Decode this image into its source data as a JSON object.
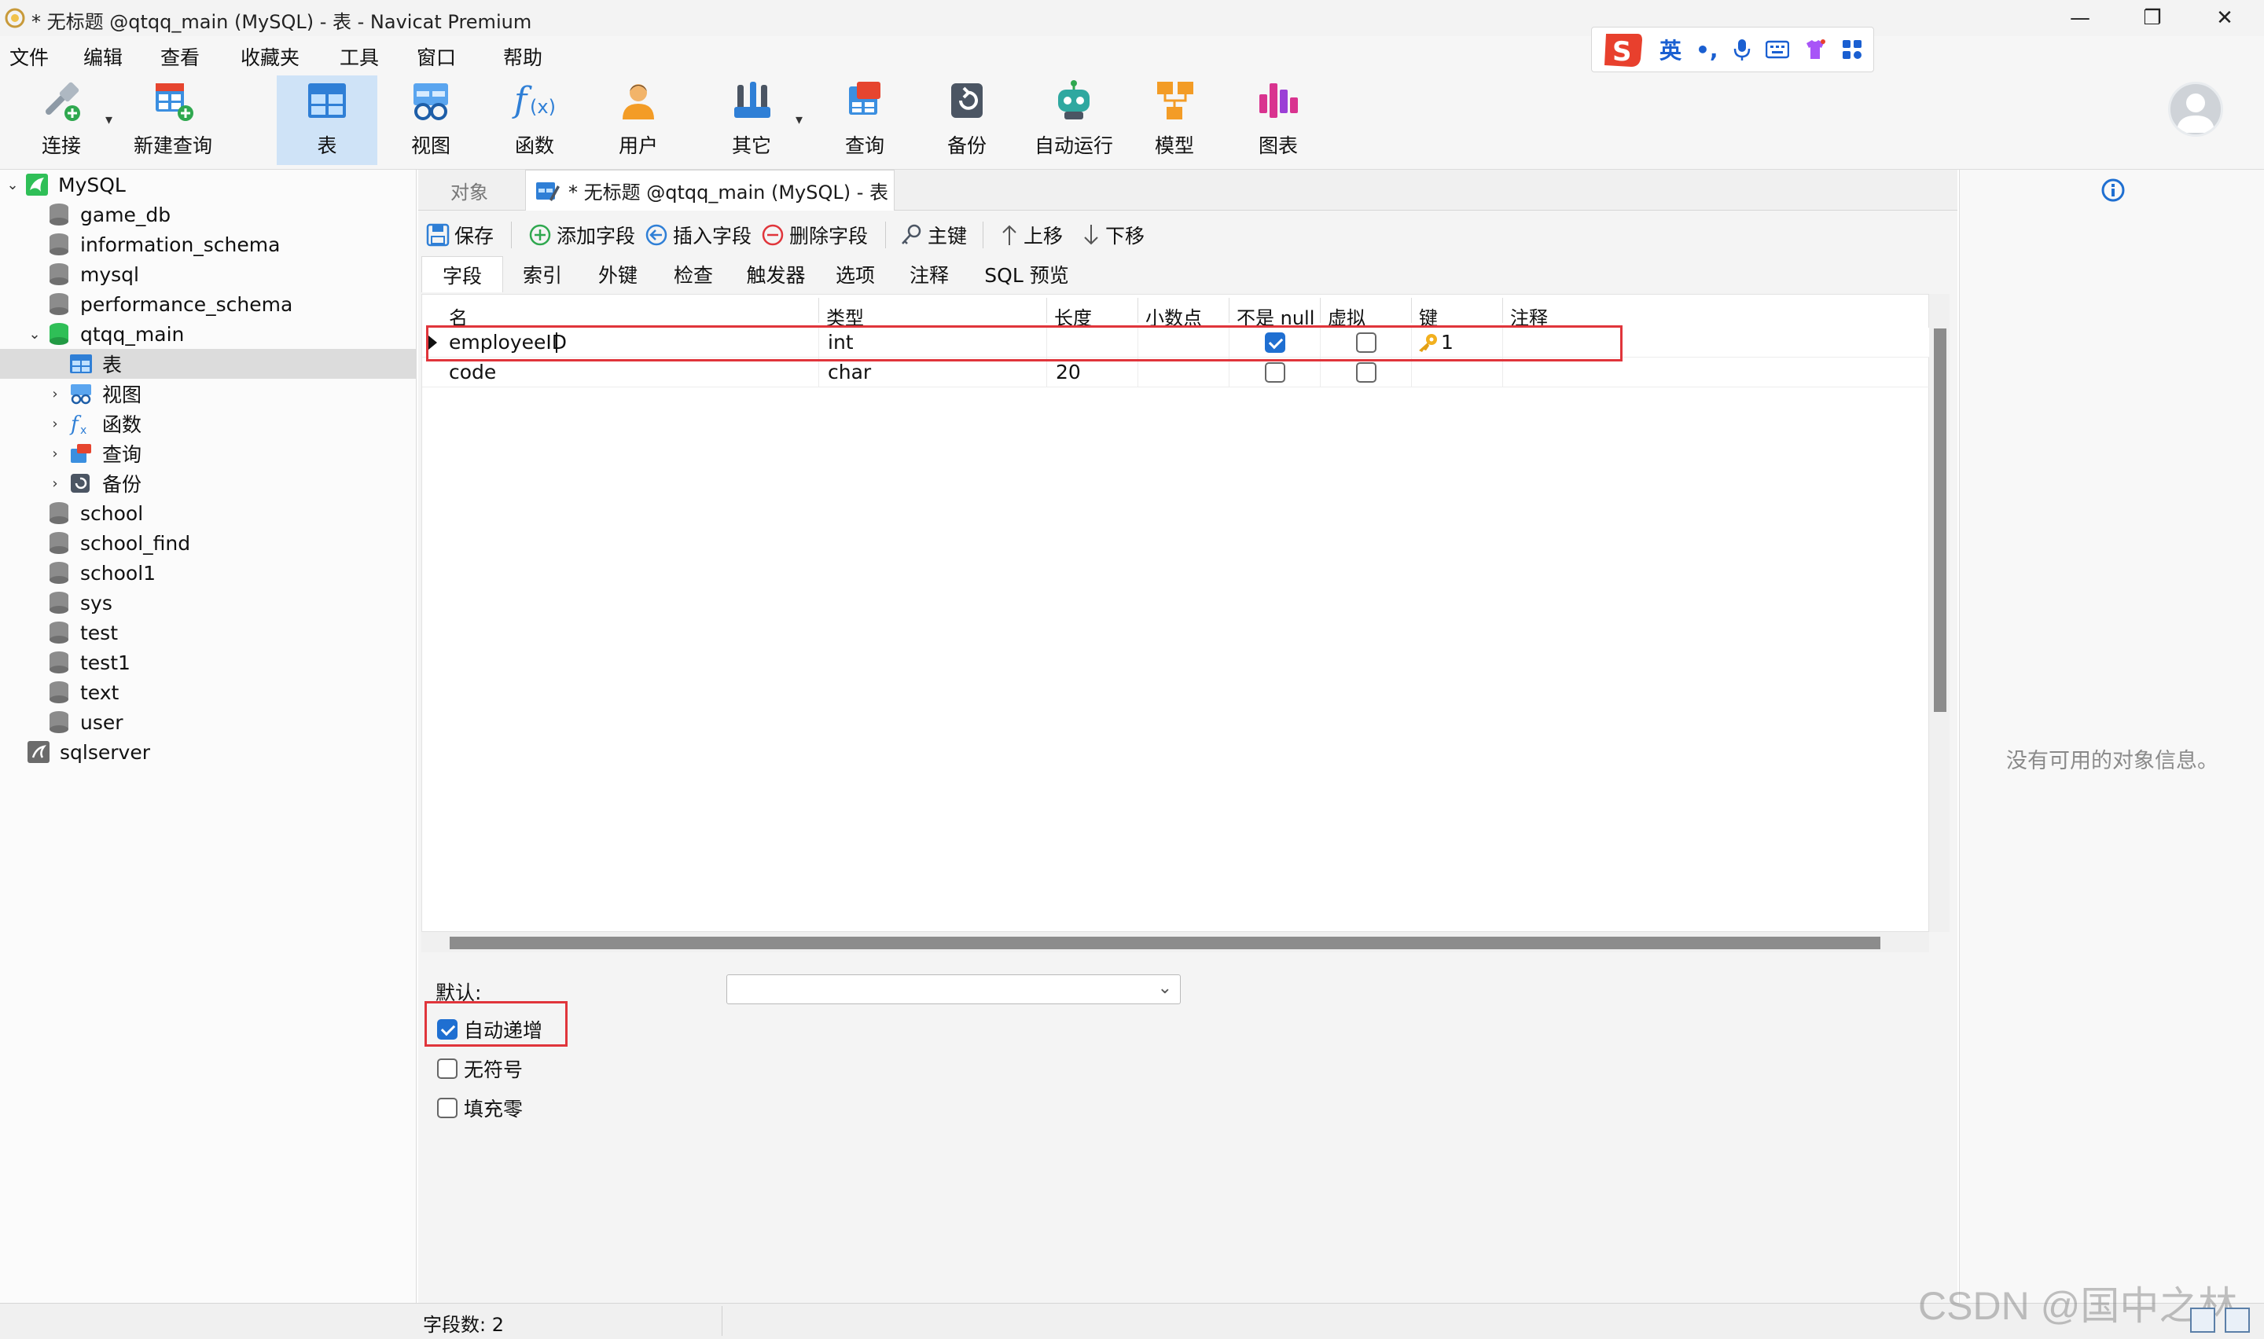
{
  "window": {
    "title": "* 无标题 @qtqq_main (MySQL) - 表 - Navicat Premium",
    "minimize": "—",
    "restore": "❐",
    "close": "✕"
  },
  "ime": {
    "lang": "英",
    "punct": "•,",
    "colors": {
      "logo": "#e8402d",
      "blue": "#1a5fd1"
    }
  },
  "menu": [
    "文件",
    "编辑",
    "查看",
    "收藏夹",
    "工具",
    "窗口",
    "帮助"
  ],
  "toolbar": [
    {
      "label": "连接",
      "icon": "connect-icon",
      "active": false
    },
    {
      "label": "新建查询",
      "icon": "new-query-icon",
      "active": false
    },
    {
      "label": "表",
      "icon": "table-icon",
      "active": true
    },
    {
      "label": "视图",
      "icon": "view-icon",
      "active": false
    },
    {
      "label": "函数",
      "icon": "function-icon",
      "active": false
    },
    {
      "label": "用户",
      "icon": "user-icon",
      "active": false
    },
    {
      "label": "其它",
      "icon": "tools-icon",
      "active": false
    },
    {
      "label": "查询",
      "icon": "query-icon",
      "active": false
    },
    {
      "label": "备份",
      "icon": "backup-icon",
      "active": false
    },
    {
      "label": "自动运行",
      "icon": "robot-icon",
      "active": false
    },
    {
      "label": "模型",
      "icon": "model-icon",
      "active": false
    },
    {
      "label": "图表",
      "icon": "chart-icon",
      "active": false
    }
  ],
  "navigator": {
    "connection": "MySQL",
    "databases": [
      "game_db",
      "information_schema",
      "mysql",
      "performance_schema",
      "qtqq_main"
    ],
    "qtqq_children": [
      "表",
      "视图",
      "函数",
      "查询",
      "备份"
    ],
    "more_databases": [
      "school",
      "school_find",
      "school1",
      "sys",
      "test",
      "test1",
      "text",
      "user"
    ],
    "other_connection": "sqlserver",
    "selected": "表"
  },
  "tabs": {
    "objects": "对象",
    "active": "* 无标题 @qtqq_main (MySQL) - 表"
  },
  "editor_toolbar": {
    "save": "保存",
    "add_field": "添加字段",
    "insert_field": "插入字段",
    "delete_field": "删除字段",
    "primary_key": "主键",
    "move_up": "上移",
    "move_down": "下移"
  },
  "subtabs": [
    "字段",
    "索引",
    "外键",
    "检查",
    "触发器",
    "选项",
    "注释",
    "SQL 预览"
  ],
  "grid": {
    "columns": [
      "名",
      "类型",
      "长度",
      "小数点",
      "不是 null",
      "虚拟",
      "键",
      "注释"
    ],
    "rows": [
      {
        "name": "employeeID",
        "type": "int",
        "length": "",
        "decimals": "",
        "not_null": true,
        "virtual": false,
        "key": "1",
        "comment": ""
      },
      {
        "name": "code",
        "type": "char",
        "length": "20",
        "decimals": "",
        "not_null": false,
        "virtual": false,
        "key": "",
        "comment": ""
      }
    ]
  },
  "properties": {
    "default_label": "默认:",
    "default_value": "",
    "auto_increment": {
      "label": "自动递增",
      "checked": true
    },
    "unsigned": {
      "label": "无符号",
      "checked": false
    },
    "zerofill": {
      "label": "填充零",
      "checked": false
    }
  },
  "info_panel": {
    "message": "没有可用的对象信息。"
  },
  "status": {
    "field_count": "字段数: 2"
  },
  "watermark": "CSDN @国中之林",
  "colors": {
    "accent": "#1f6fd1",
    "highlight": "#e0353b",
    "active_tool": "#cfe3f7"
  }
}
